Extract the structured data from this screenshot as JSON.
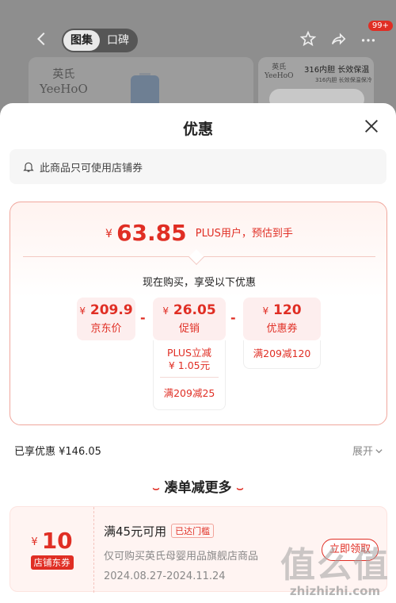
{
  "background": {
    "tabs": [
      "图集",
      "口碑"
    ],
    "active_tab": "图集",
    "cart_badge": "99+",
    "brand_logo": "英氏\nYeeHoO",
    "card2_logo": "英氏\nYeeHoO",
    "card2_headline": "316内胆 长效保温",
    "card2_subline": "316内胆 长效保温保冷"
  },
  "sheet": {
    "title": "优惠",
    "notice": "此商品只可使用店铺券"
  },
  "price": {
    "currency": "¥",
    "final_amount": "63.85",
    "final_note": "PLUS用户，预估到手",
    "caption": "现在购买，享受以下优惠"
  },
  "breakdown": {
    "jd_price_value": "209.9",
    "jd_price_label": "京东价",
    "minus1": "-",
    "promo_value": "26.05",
    "promo_label": "促销",
    "promo_detail_1": "PLUS立减\n¥ 1.05元",
    "promo_detail_2": "满209减25",
    "minus2": "-",
    "coupon_value": "120",
    "coupon_label": "优惠券",
    "coupon_detail": "满209减120",
    "yen": "¥"
  },
  "summary": {
    "saved": "已享优惠 ¥146.05",
    "expand": "展开"
  },
  "more": {
    "title": "凑单减更多",
    "coupon": {
      "currency": "¥",
      "amount": "10",
      "tag": "店铺东券",
      "condition": "满45元可用",
      "chip": "已达门槛",
      "description": "仅可购买英氏母婴用品旗舰店商品",
      "dates": "2024.08.27-2024.11.24",
      "button": "立即领取"
    }
  },
  "watermark": {
    "big": "值么值",
    "small": "zhizhizhi.com"
  },
  "colors": {
    "accent": "#e02e24",
    "sheet_bg": "#ffffff"
  }
}
